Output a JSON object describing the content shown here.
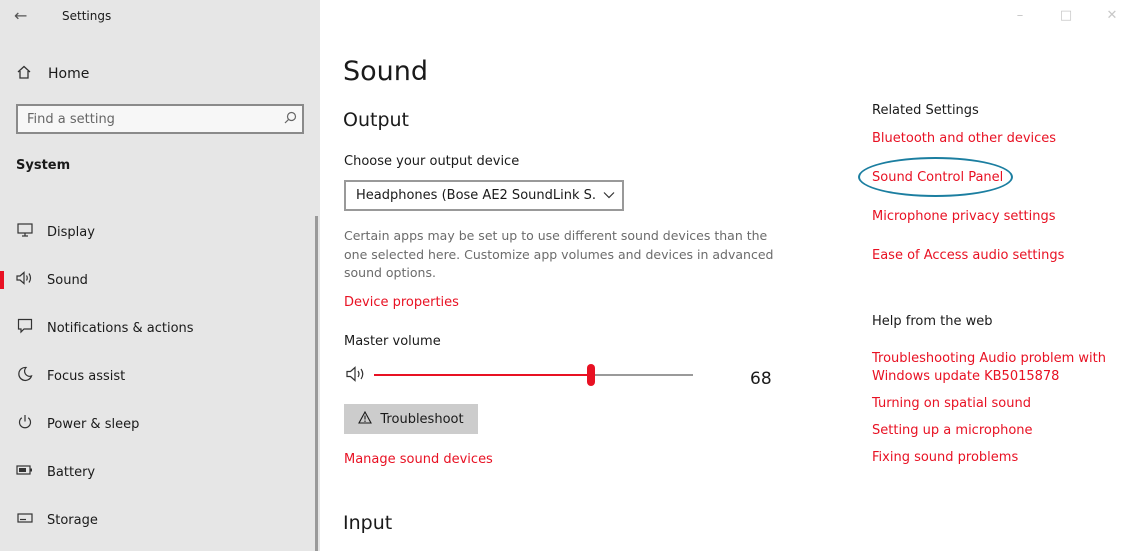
{
  "window": {
    "title": "Settings",
    "back_icon": "←",
    "controls": [
      "–",
      "□",
      "✕"
    ]
  },
  "sidebar": {
    "home_label": "Home",
    "search_placeholder": "Find a setting",
    "section": "System",
    "items": [
      {
        "label": "Display",
        "icon": "display-icon"
      },
      {
        "label": "Sound",
        "icon": "sound-icon",
        "active": true
      },
      {
        "label": "Notifications & actions",
        "icon": "notifications-icon"
      },
      {
        "label": "Focus assist",
        "icon": "focus-assist-icon"
      },
      {
        "label": "Power & sleep",
        "icon": "power-icon"
      },
      {
        "label": "Battery",
        "icon": "battery-icon"
      },
      {
        "label": "Storage",
        "icon": "storage-icon"
      }
    ]
  },
  "main": {
    "title": "Sound",
    "output": {
      "heading": "Output",
      "choose_label": "Choose your output device",
      "device_value": "Headphones (Bose AE2 SoundLink S...",
      "help_text": "Certain apps may be set up to use different sound devices than the one selected here. Customize app volumes and devices in advanced sound options.",
      "device_properties_link": "Device properties",
      "master_volume_label": "Master volume",
      "volume": 68,
      "volume_display": "68",
      "troubleshoot_label": "Troubleshoot",
      "manage_link": "Manage sound devices"
    },
    "input": {
      "heading": "Input"
    }
  },
  "related": {
    "heading": "Related Settings",
    "links": [
      "Bluetooth and other devices",
      "Sound Control Panel",
      "Microphone privacy settings",
      "Ease of Access audio settings"
    ],
    "help_heading": "Help from the web",
    "help_links": [
      "Troubleshooting Audio problem with Windows update KB5015878",
      "Turning on spatial sound",
      "Setting up a microphone",
      "Fixing sound problems"
    ]
  },
  "colors": {
    "accent": "#e81123",
    "sidebar_bg": "#e6e6e6",
    "highlight": "#1b7ea0"
  }
}
